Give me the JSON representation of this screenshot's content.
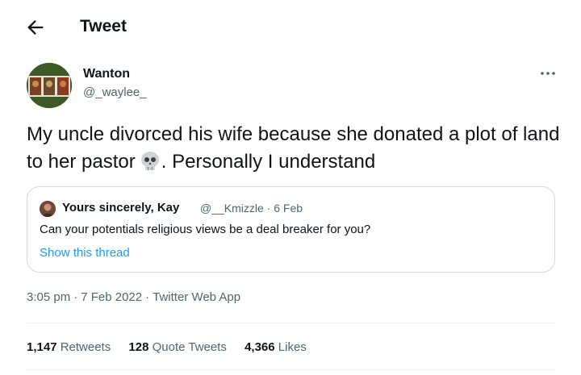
{
  "header": {
    "title": "Tweet"
  },
  "tweet": {
    "author_name": "Wanton",
    "author_handle": "@_waylee_",
    "text_part1": "My uncle divorced his wife because she donated a plot of land to her pastor",
    "text_part2": ". Personally I understand",
    "emoji_icon": "skull-icon",
    "time": "3:05 pm",
    "date": "7 Feb 2022",
    "app": "Twitter Web App"
  },
  "quote": {
    "author_name": "Yours sincerely, Kay",
    "author_handle": "@__Kmizzle",
    "date": "6 Feb",
    "text": "Can your potentials religious views be a deal breaker for you?",
    "link": "Show this thread"
  },
  "stats": {
    "retweets_count": "1,147",
    "retweets_label": "Retweets",
    "quotes_count": "128",
    "quotes_label": "Quote Tweets",
    "likes_count": "4,366",
    "likes_label": "Likes"
  },
  "colors": {
    "link": "#1d9bf0",
    "secondary_text": "#536471",
    "border": "#cfd9de"
  }
}
